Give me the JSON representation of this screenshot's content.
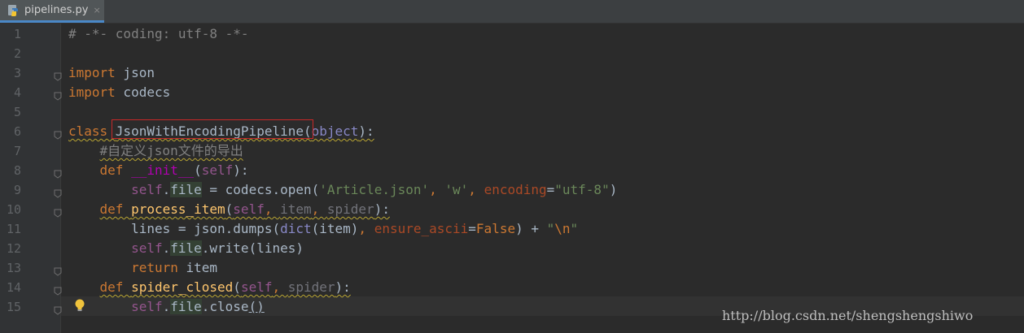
{
  "tab": {
    "label": "pipelines.py",
    "close": "×"
  },
  "watermark": "http://blog.csdn.net/shengshengshiwo",
  "line_numbers": [
    "1",
    "2",
    "3",
    "4",
    "5",
    "6",
    "7",
    "8",
    "9",
    "10",
    "11",
    "12",
    "13",
    "14",
    "15"
  ],
  "lines": [
    [
      {
        "t": "# -*- coding: utf-8 -*-",
        "c": "cmt"
      }
    ],
    [],
    [
      {
        "t": "import",
        "c": "kw"
      },
      {
        "t": " json",
        "c": ""
      }
    ],
    [
      {
        "t": "import",
        "c": "kw"
      },
      {
        "t": " codecs",
        "c": ""
      }
    ],
    [],
    [
      {
        "t": "class ",
        "c": "kw wavy"
      },
      {
        "t": "JsonWithEncodingPipeline",
        "c": "wavy"
      },
      {
        "t": "(",
        "c": "wavy"
      },
      {
        "t": "object",
        "c": "builtin wavy"
      },
      {
        "t": "):",
        "c": "wavy"
      }
    ],
    [
      {
        "t": "    ",
        "c": ""
      },
      {
        "t": "#自定义json文件的导出",
        "c": "cmt wavy"
      }
    ],
    [
      {
        "t": "    ",
        "c": ""
      },
      {
        "t": "def ",
        "c": "kw"
      },
      {
        "t": "__init__",
        "c": "magic"
      },
      {
        "t": "(",
        "c": ""
      },
      {
        "t": "self",
        "c": "selfk"
      },
      {
        "t": "):",
        "c": ""
      }
    ],
    [
      {
        "t": "        ",
        "c": ""
      },
      {
        "t": "self",
        "c": "selfk"
      },
      {
        "t": ".",
        "c": ""
      },
      {
        "t": "file",
        "c": "field"
      },
      {
        "t": " = codecs.open(",
        "c": ""
      },
      {
        "t": "'Article.json'",
        "c": "str"
      },
      {
        "t": ", ",
        "c": "kw"
      },
      {
        "t": "'w'",
        "c": "str"
      },
      {
        "t": ", ",
        "c": "kw"
      },
      {
        "t": "encoding",
        "c": "kwarg"
      },
      {
        "t": "=",
        "c": ""
      },
      {
        "t": "\"utf-8\"",
        "c": "str"
      },
      {
        "t": ")",
        "c": ""
      }
    ],
    [
      {
        "t": "    ",
        "c": ""
      },
      {
        "t": "def ",
        "c": "kw wavy"
      },
      {
        "t": "process_item",
        "c": "fn wavy"
      },
      {
        "t": "(",
        "c": "wavy"
      },
      {
        "t": "self",
        "c": "selfk wavy"
      },
      {
        "t": ", ",
        "c": "kw wavy"
      },
      {
        "t": "item",
        "c": "gray wavy"
      },
      {
        "t": ", ",
        "c": "kw wavy"
      },
      {
        "t": "spider",
        "c": "gray wavy"
      },
      {
        "t": "):",
        "c": "wavy"
      }
    ],
    [
      {
        "t": "        lines = json.dumps(",
        "c": ""
      },
      {
        "t": "dict",
        "c": "builtin"
      },
      {
        "t": "(item)",
        "c": ""
      },
      {
        "t": ", ",
        "c": "kw"
      },
      {
        "t": "ensure_ascii",
        "c": "kwarg"
      },
      {
        "t": "=",
        "c": ""
      },
      {
        "t": "False",
        "c": "kw"
      },
      {
        "t": ") + ",
        "c": ""
      },
      {
        "t": "\"",
        "c": "str"
      },
      {
        "t": "\\n",
        "c": "kw"
      },
      {
        "t": "\"",
        "c": "str"
      }
    ],
    [
      {
        "t": "        ",
        "c": ""
      },
      {
        "t": "self",
        "c": "selfk"
      },
      {
        "t": ".",
        "c": ""
      },
      {
        "t": "file",
        "c": "field"
      },
      {
        "t": ".write(lines)",
        "c": ""
      }
    ],
    [
      {
        "t": "        ",
        "c": ""
      },
      {
        "t": "return ",
        "c": "kw"
      },
      {
        "t": "item",
        "c": ""
      }
    ],
    [
      {
        "t": "    ",
        "c": ""
      },
      {
        "t": "def ",
        "c": "kw wavy"
      },
      {
        "t": "spider_closed",
        "c": "fn wavy"
      },
      {
        "t": "(",
        "c": "wavy"
      },
      {
        "t": "self",
        "c": "selfk wavy"
      },
      {
        "t": ", ",
        "c": "kw wavy"
      },
      {
        "t": "spider",
        "c": "gray wavy"
      },
      {
        "t": "):",
        "c": "wavy"
      }
    ],
    [
      {
        "t": "        ",
        "c": ""
      },
      {
        "t": "self",
        "c": "selfk"
      },
      {
        "t": ".",
        "c": ""
      },
      {
        "t": "file",
        "c": "field"
      },
      {
        "t": ".close",
        "c": ""
      },
      {
        "t": "()",
        "c": "underline-solid"
      }
    ]
  ],
  "folds": [
    3,
    4,
    6,
    8,
    9,
    10,
    13,
    14,
    15
  ],
  "colors": {
    "editor_bg": "#2b2b2b",
    "keyword": "#cc7832",
    "string": "#6a8759",
    "self": "#94558d",
    "function": "#ffc66d",
    "highlight_box": "#c82828"
  },
  "icons": {
    "tab_file": "python-file-icon",
    "gutter": "fold-marker-icon",
    "intention": "lightbulb-icon"
  }
}
